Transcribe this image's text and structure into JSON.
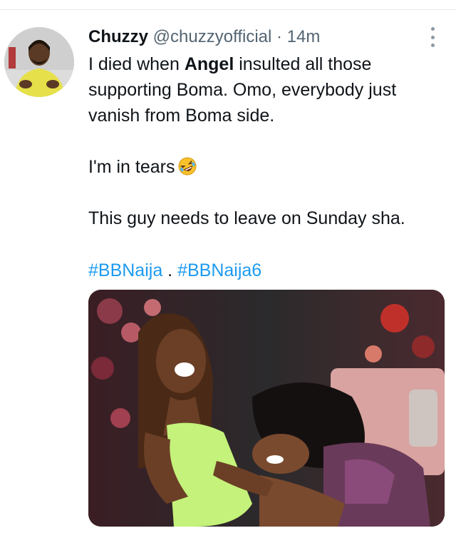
{
  "tweet": {
    "author_name": "Chuzzy",
    "author_handle": "@chuzzyofficial",
    "separator": "·",
    "time": "14m",
    "avatar_icon": "profile-photo",
    "more_icon": "vertical-ellipsis-icon",
    "text": {
      "line1_before": "I died when ",
      "line1_bold": "Angel",
      "line1_after": " insulted all those supporting Boma. Omo, everybody just vanish from Boma side.",
      "paragraph2": "I'm in tears",
      "paragraph2_emoji": "rolling-on-the-floor-laughing-emoji",
      "paragraph3": "This guy needs to leave on Sunday sha."
    },
    "hashtags": [
      "#BBNaija",
      "#BBNaija6"
    ],
    "hashtag_separator": " . ",
    "media": {
      "kind": "photo",
      "subject": "two women laughing on a couch"
    }
  },
  "colors": {
    "link": "#1d9bf0",
    "secondary_text": "#536471",
    "primary_text": "#0f1419"
  }
}
